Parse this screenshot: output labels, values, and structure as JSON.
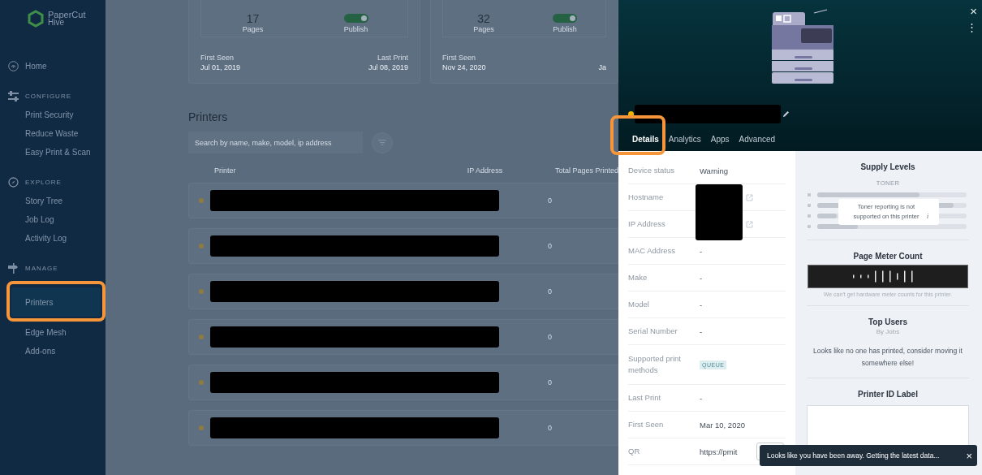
{
  "sidebar": {
    "logo": {
      "line1": "PaperCut",
      "line2": "Hive"
    },
    "items": [
      {
        "kind": "top_link",
        "label": "Home",
        "selected": false
      },
      {
        "kind": "heading",
        "label": "CONFIGURE"
      },
      {
        "kind": "link",
        "label": "Print Security",
        "selected": false
      },
      {
        "kind": "link",
        "label": "Reduce Waste",
        "selected": false
      },
      {
        "kind": "link",
        "label": "Easy Print & Scan",
        "selected": false
      },
      {
        "kind": "heading",
        "label": "EXPLORE"
      },
      {
        "kind": "link",
        "label": "Story Tree",
        "selected": false
      },
      {
        "kind": "link",
        "label": "Job Log",
        "selected": false
      },
      {
        "kind": "link",
        "label": "Activity Log",
        "selected": false
      },
      {
        "kind": "heading",
        "label": "MANAGE"
      },
      {
        "kind": "link",
        "label": "Printers",
        "selected": true
      },
      {
        "kind": "link",
        "label": "Edge Mesh",
        "selected": false
      },
      {
        "kind": "link",
        "label": "Add-ons",
        "selected": false
      }
    ]
  },
  "cards": [
    {
      "count": "17",
      "count_label": "Pages",
      "toggle_label": "Publish",
      "on": true,
      "first_seen_label": "First Seen",
      "first_seen": "Jul 01, 2019",
      "last_print_label": "Last Print",
      "last_print": "Jul 08, 2019"
    },
    {
      "count": "32",
      "count_label": "Pages",
      "toggle_label": "Publish",
      "on": true,
      "first_seen_label": "First Seen",
      "first_seen": "Nov 24, 2020",
      "last_print": "Ja"
    }
  ],
  "printers": {
    "title": "Printers",
    "search": {
      "placeholder": "Search by name, make, model, ip address"
    },
    "columns": [
      "Printer",
      "IP Address",
      "Total Pages Printed"
    ],
    "rows": [
      {
        "color": "#8f7c3c",
        "total_pages": "0"
      },
      {
        "color": "#8f7c3c",
        "total_pages": "0"
      },
      {
        "color": "#8f7c3c",
        "total_pages": "0"
      },
      {
        "color": "#8f7c3c",
        "total_pages": "0"
      },
      {
        "color": "#8f7c3c",
        "total_pages": "0"
      },
      {
        "color": "#8f7c3c",
        "total_pages": "0"
      }
    ]
  },
  "panel": {
    "close": "×",
    "menu": "⋮",
    "status_dot": {
      "color": "#f5b400"
    },
    "tabs": [
      {
        "label": "Details",
        "selected": true
      },
      {
        "label": "Analytics",
        "selected": false
      },
      {
        "label": "Apps",
        "selected": false
      },
      {
        "label": "Advanced",
        "selected": false
      }
    ],
    "details": [
      {
        "kind": "text",
        "label": "Device status",
        "value": "Warning"
      },
      {
        "kind": "hidden_link",
        "label": "Hostname"
      },
      {
        "kind": "hidden_link",
        "label": "IP Address"
      },
      {
        "kind": "text",
        "label": "MAC Address",
        "value": "-"
      },
      {
        "kind": "text",
        "label": "Make",
        "value": "-"
      },
      {
        "kind": "text",
        "label": "Model",
        "value": "-"
      },
      {
        "kind": "text",
        "label": "Serial Number",
        "value": "-"
      },
      {
        "kind": "badge",
        "label": "Supported print methods",
        "value": "QUEUE"
      },
      {
        "kind": "text",
        "label": "Last Print",
        "value": "-"
      },
      {
        "kind": "text",
        "label": "First Seen",
        "value": "Mar 10, 2020"
      },
      {
        "kind": "copy",
        "label": "QR",
        "value": "https://pmit"
      }
    ],
    "supply": {
      "title": "Supply Levels",
      "subtitle": "TONER",
      "note": "Toner reporting is not supported on this printer",
      "note_icon": "i"
    },
    "meter": {
      "title": "Page Meter Count",
      "note": "We can't get hardware meter counts for this printer."
    },
    "top_users": {
      "title": "Top Users",
      "subtitle": "By Jobs",
      "message": "Looks like no one has printed, consider moving it somewhere else!"
    },
    "id_label": {
      "title": "Printer ID Label"
    }
  },
  "toast": {
    "message": "Looks like you have been away. Getting the latest data...",
    "close": "×"
  }
}
